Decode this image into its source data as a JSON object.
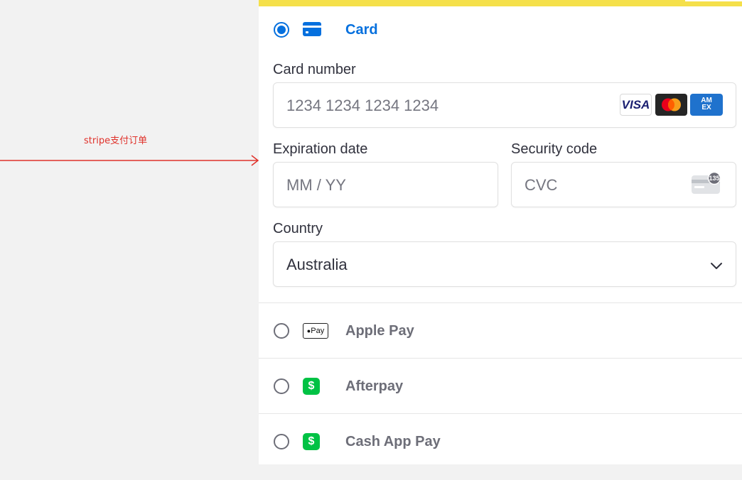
{
  "annotation": {
    "text": "stripe支付订单"
  },
  "methods": {
    "card": {
      "label": "Card"
    },
    "apple_pay": {
      "label": "Apple Pay",
      "icon_text": "Pay"
    },
    "afterpay": {
      "label": "Afterpay",
      "icon_text": "$"
    },
    "cash_app": {
      "label": "Cash App Pay",
      "icon_text": "$"
    }
  },
  "form": {
    "card_number": {
      "label": "Card number",
      "placeholder": "1234 1234 1234 1234"
    },
    "expiration": {
      "label": "Expiration date",
      "placeholder": "MM / YY"
    },
    "security": {
      "label": "Security code",
      "placeholder": "CVC",
      "badge": "135"
    },
    "country": {
      "label": "Country",
      "value": "Australia"
    }
  },
  "brands": {
    "visa": "VISA",
    "amex_line1": "AM",
    "amex_line2": "EX"
  },
  "colors": {
    "accent": "#0570de",
    "annotation": "#e0322b",
    "banner": "#f5e04a",
    "cash_green": "#00c244"
  }
}
